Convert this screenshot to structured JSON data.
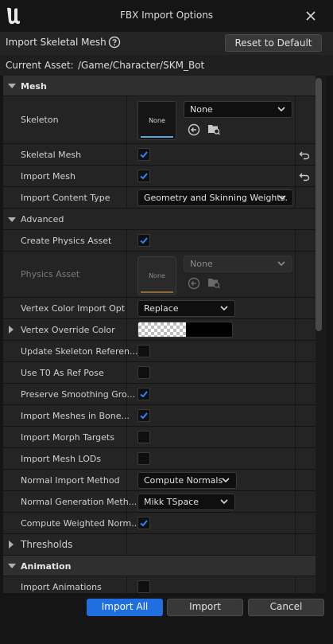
{
  "window": {
    "title": "FBX Import Options"
  },
  "header": {
    "label": "Import Skeletal Mesh",
    "reset_label": "Reset to Default"
  },
  "asset": {
    "label": "Current Asset:",
    "path": "/Game/Character/SKM_Bot"
  },
  "categories": {
    "mesh": "Mesh",
    "advanced": "Advanced",
    "thresholds": "Thresholds",
    "animation": "Animation"
  },
  "props": {
    "skeleton": {
      "label": "Skeleton",
      "thumb": "None",
      "value": "None"
    },
    "skeletal_mesh": {
      "label": "Skeletal Mesh",
      "checked": true
    },
    "import_mesh": {
      "label": "Import Mesh",
      "checked": true
    },
    "import_content_type": {
      "label": "Import Content Type",
      "value": "Geometry and Skinning Weights."
    },
    "create_physics_asset": {
      "label": "Create Physics Asset",
      "checked": true
    },
    "physics_asset": {
      "label": "Physics Asset",
      "thumb": "None",
      "value": "None"
    },
    "vertex_color_import_option": {
      "label": "Vertex Color Import Option",
      "value": "Replace"
    },
    "vertex_override_color": {
      "label": "Vertex Override Color"
    },
    "update_skeleton_reference": {
      "label": "Update Skeleton Referen...",
      "checked": false
    },
    "use_t0_as_ref_pose": {
      "label": "Use T0 As Ref Pose",
      "checked": false
    },
    "preserve_smoothing_groups": {
      "label": "Preserve Smoothing Gro...",
      "checked": true
    },
    "import_meshes_in_bone_hierarchy": {
      "label": "Import Meshes in Bone...",
      "checked": true
    },
    "import_morph_targets": {
      "label": "Import Morph Targets",
      "checked": false
    },
    "import_mesh_lods": {
      "label": "Import Mesh LODs",
      "checked": false
    },
    "normal_import_method": {
      "label": "Normal Import Method",
      "value": "Compute Normals"
    },
    "normal_generation_method": {
      "label": "Normal Generation Meth...",
      "value": "Mikk TSpace"
    },
    "compute_weighted_normals": {
      "label": "Compute Weighted Norm...",
      "checked": true
    },
    "import_animations": {
      "label": "Import Animations",
      "checked": false
    }
  },
  "footer": {
    "import_all": "Import All",
    "import": "Import",
    "cancel": "Cancel"
  },
  "colors": {
    "accent": "#1f6fe0",
    "check": "#2e86ff",
    "thumb_bar": "#5aa7d8",
    "thumb_bar_disabled": "#8a6a3a"
  }
}
